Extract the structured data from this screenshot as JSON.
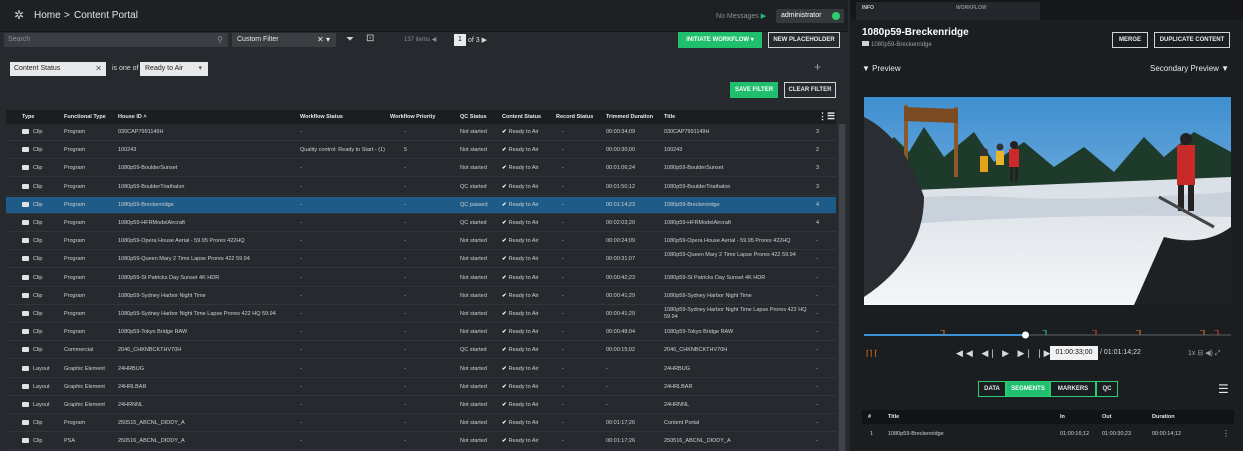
{
  "header": {
    "home": "Home",
    "sep": ">",
    "section": "Content Portal",
    "messages": "No Messages",
    "user": "administrator"
  },
  "toolbar": {
    "search_placeholder": "Search",
    "custom_filter": "Custom Filter",
    "items_count": "137 items",
    "page": "1",
    "page_of": "of 3",
    "initiate_workflow": "INITIATE WORKFLOW ▾",
    "new_placeholder": "NEW PLACEHOLDER"
  },
  "filter": {
    "field": "Content Status",
    "operator": "is one of",
    "value": "Ready to Air",
    "save": "SAVE FILTER",
    "clear": "CLEAR FILTER"
  },
  "table": {
    "headers": [
      "Type",
      "Functional Type",
      "House ID ˄",
      "Workflow Status",
      "Workflow Priority",
      "QC Status",
      "Content Status",
      "Record Status",
      "Trimmed Duration",
      "Title"
    ],
    "rows": [
      {
        "type": "Clip",
        "ftype": "Program",
        "hid": "030CAP7991149H",
        "wf": "-",
        "prio": "-",
        "qc": "Not started",
        "cs": "Ready to Air",
        "rs": "-",
        "dur": "00:00:34;09",
        "title": "030CAP7991149H",
        "n": "3"
      },
      {
        "type": "Clip",
        "ftype": "Program",
        "hid": "100243",
        "wf": "Quality control: Ready to Start - (1)",
        "prio": "5",
        "qc": "Not started",
        "cs": "Ready to Air",
        "rs": "-",
        "dur": "00:00:30;00",
        "title": "100243",
        "n": "2"
      },
      {
        "type": "Clip",
        "ftype": "Program",
        "hid": "1080p59-BoulderSunset",
        "wf": "-",
        "prio": "-",
        "qc": "Not started",
        "cs": "Ready to Air",
        "rs": "-",
        "dur": "00:01:06;24",
        "title": "1080p59-BoulderSunset",
        "n": "3"
      },
      {
        "type": "Clip",
        "ftype": "Program",
        "hid": "1080p59-BoulderTriathalon",
        "wf": "-",
        "prio": "-",
        "qc": "QC started",
        "cs": "Ready to Air",
        "rs": "-",
        "dur": "00:01:50;12",
        "title": "1080p59-BoulderTriathalon",
        "n": "3"
      },
      {
        "type": "Clip",
        "ftype": "Program",
        "hid": "1080p59-Breckenridge",
        "wf": "-",
        "prio": "-",
        "qc": "QC passed",
        "cs": "Ready to Air",
        "rs": "-",
        "dur": "00:01:14;23",
        "title": "1080p59-Breckenridge",
        "n": "4",
        "sel": true
      },
      {
        "type": "Clip",
        "ftype": "Program",
        "hid": "1080p59-HFRModelAircraft",
        "wf": "-",
        "prio": "-",
        "qc": "QC started",
        "cs": "Ready to Air",
        "rs": "-",
        "dur": "00:02:03;20",
        "title": "1080p59-HFRModelAircraft",
        "n": "4"
      },
      {
        "type": "Clip",
        "ftype": "Program",
        "hid": "1080p59-Opera House Aerial - 59.95 Prores 422HQ",
        "wf": "-",
        "prio": "-",
        "qc": "Not started",
        "cs": "Ready to Air",
        "rs": "-",
        "dur": "00:00:24;09",
        "title": "1080p59-Opera House Aerial - 59.95 Prores 422HQ",
        "n": "-"
      },
      {
        "type": "Clip",
        "ftype": "Program",
        "hid": "1080p59-Queen Mary 2 Time Lapse Prores 422 59.94",
        "wf": "-",
        "prio": "-",
        "qc": "Not started",
        "cs": "Ready to Air",
        "rs": "-",
        "dur": "00:00:31;07",
        "title": "1080p59-Queen Mary 2 Time Lapse Prores 422 59.94",
        "n": "-",
        "two": true
      },
      {
        "type": "Clip",
        "ftype": "Program",
        "hid": "1080p59-St Patricks Day Sunset 4K HDR",
        "wf": "-",
        "prio": "-",
        "qc": "Not started",
        "cs": "Ready to Air",
        "rs": "-",
        "dur": "00:00:42;23",
        "title": "1080p59-St Patricks Day Sunset 4K HDR",
        "n": "-"
      },
      {
        "type": "Clip",
        "ftype": "Program",
        "hid": "1080p59-Sydney Harbor Night Time",
        "wf": "-",
        "prio": "-",
        "qc": "Not started",
        "cs": "Ready to Air",
        "rs": "-",
        "dur": "00:00:41;29",
        "title": "1080p59-Sydney Harbor Night Time",
        "n": "-"
      },
      {
        "type": "Clip",
        "ftype": "Program",
        "hid": "1080p59-Sydney Harbor Night Time Lapse Prores 422 HQ 59.94",
        "wf": "-",
        "prio": "-",
        "qc": "Not started",
        "cs": "Ready to Air",
        "rs": "-",
        "dur": "00:00:41;29",
        "title": "1080p59-Sydney Harbor Night Time Lapse Prores 422 HQ 59.94",
        "n": "-",
        "two": true
      },
      {
        "type": "Clip",
        "ftype": "Program",
        "hid": "1080p59-Tokyo Bridge RAW",
        "wf": "-",
        "prio": "-",
        "qc": "Not started",
        "cs": "Ready to Air",
        "rs": "-",
        "dur": "00:00:48;04",
        "title": "1080p59-Tokyo Bridge RAW",
        "n": "-"
      },
      {
        "type": "Clip",
        "ftype": "Commercial",
        "hid": "2046_CHKNBCKTHV70H",
        "wf": "-",
        "prio": "-",
        "qc": "QC started",
        "cs": "Ready to Air",
        "rs": "-",
        "dur": "00:00:15;02",
        "title": "2046_CHKNBCKTHV70H",
        "n": "-"
      },
      {
        "type": "Layout",
        "ftype": "Graphic Element",
        "hid": "24HRBUG",
        "wf": "-",
        "prio": "-",
        "qc": "Not started",
        "cs": "Ready to Air",
        "rs": "-",
        "dur": "-",
        "title": "24HRBUG",
        "n": "-"
      },
      {
        "type": "Layout",
        "ftype": "Graphic Element",
        "hid": "24HRLBAR",
        "wf": "-",
        "prio": "-",
        "qc": "Not started",
        "cs": "Ready to Air",
        "rs": "-",
        "dur": "-",
        "title": "24HRLBAR",
        "n": "-"
      },
      {
        "type": "Layout",
        "ftype": "Graphic Element",
        "hid": "24HRNNL",
        "wf": "-",
        "prio": "-",
        "qc": "Not started",
        "cs": "Ready to Air",
        "rs": "-",
        "dur": "-",
        "title": "24HRNNL",
        "n": "-"
      },
      {
        "type": "Clip",
        "ftype": "Program",
        "hid": "250515_ABCNL_DIDDY_A",
        "wf": "-",
        "prio": "-",
        "qc": "Not started",
        "cs": "Ready to Air",
        "rs": "-",
        "dur": "00:01:17;26",
        "title": "Content Portal",
        "n": "-"
      },
      {
        "type": "Clip",
        "ftype": "PSA",
        "hid": "250516_ABCNL_DIDDY_A",
        "wf": "-",
        "prio": "-",
        "qc": "Not started",
        "cs": "Ready to Air",
        "rs": "-",
        "dur": "00:01:17;26",
        "title": "250516_ABCNL_DIDDY_A",
        "n": "-"
      }
    ]
  },
  "detail": {
    "tab_info": "INFO",
    "tab_workflow": "WORKFLOW",
    "title": "1080p59-Breckenridge",
    "subtitle": "1080p59-Breckenridge",
    "merge": "MERGE",
    "duplicate": "DUPLICATE CONTENT",
    "preview": "Preview",
    "secondary_preview": "Secondary Preview",
    "timecode": "01:00:33;00",
    "duration": "/ 01:01:14;22",
    "speed": "1x",
    "playhead_fraction": 0.44,
    "tabs": [
      "DATA",
      "SEGMENTS",
      "MARKERS",
      "QC"
    ],
    "active_tab": "SEGMENTS",
    "seg_headers": [
      "#",
      "Title",
      "In",
      "Out",
      "Duration"
    ],
    "segment": {
      "num": "1",
      "title": "1080p59-Breckenridge",
      "in": "01:00:16;12",
      "out": "01:00:30;23",
      "duration": "00:00:14;12"
    }
  },
  "colors": {
    "accent_green": "#1fbf6d",
    "selection_blue": "#1e5b86",
    "panel_dark": "#1b1e21"
  }
}
